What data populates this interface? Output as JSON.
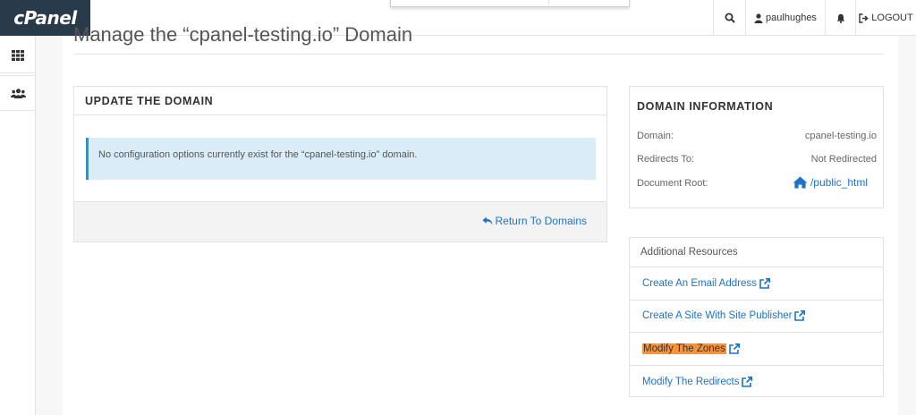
{
  "header": {
    "logo": "cPanel",
    "username": "paulhughes",
    "logout_label": "LOGOUT"
  },
  "page": {
    "title": "Manage the “cpanel-testing.io” Domain"
  },
  "update_panel": {
    "heading": "UPDATE THE DOMAIN",
    "alert": "No configuration options currently exist for the “cpanel-testing.io” domain.",
    "return_link": "Return To Domains"
  },
  "domain_info": {
    "heading": "DOMAIN INFORMATION",
    "rows": [
      {
        "label": "Domain:",
        "value": "cpanel-testing.io"
      },
      {
        "label": "Redirects To:",
        "value": "Not Redirected"
      },
      {
        "label": "Document Root:",
        "value": "/public_html"
      }
    ]
  },
  "resources": {
    "heading": "Additional Resources",
    "items": [
      {
        "label": "Create An Email Address"
      },
      {
        "label": "Create A Site With Site Publisher"
      },
      {
        "label": "Modify The Zones"
      },
      {
        "label": "Modify The Redirects"
      }
    ]
  },
  "colors": {
    "logo_bg": "#293a4a",
    "link": "#1e73c8",
    "highlight": "#f7943b",
    "alert_bg": "#d9ecf8"
  }
}
